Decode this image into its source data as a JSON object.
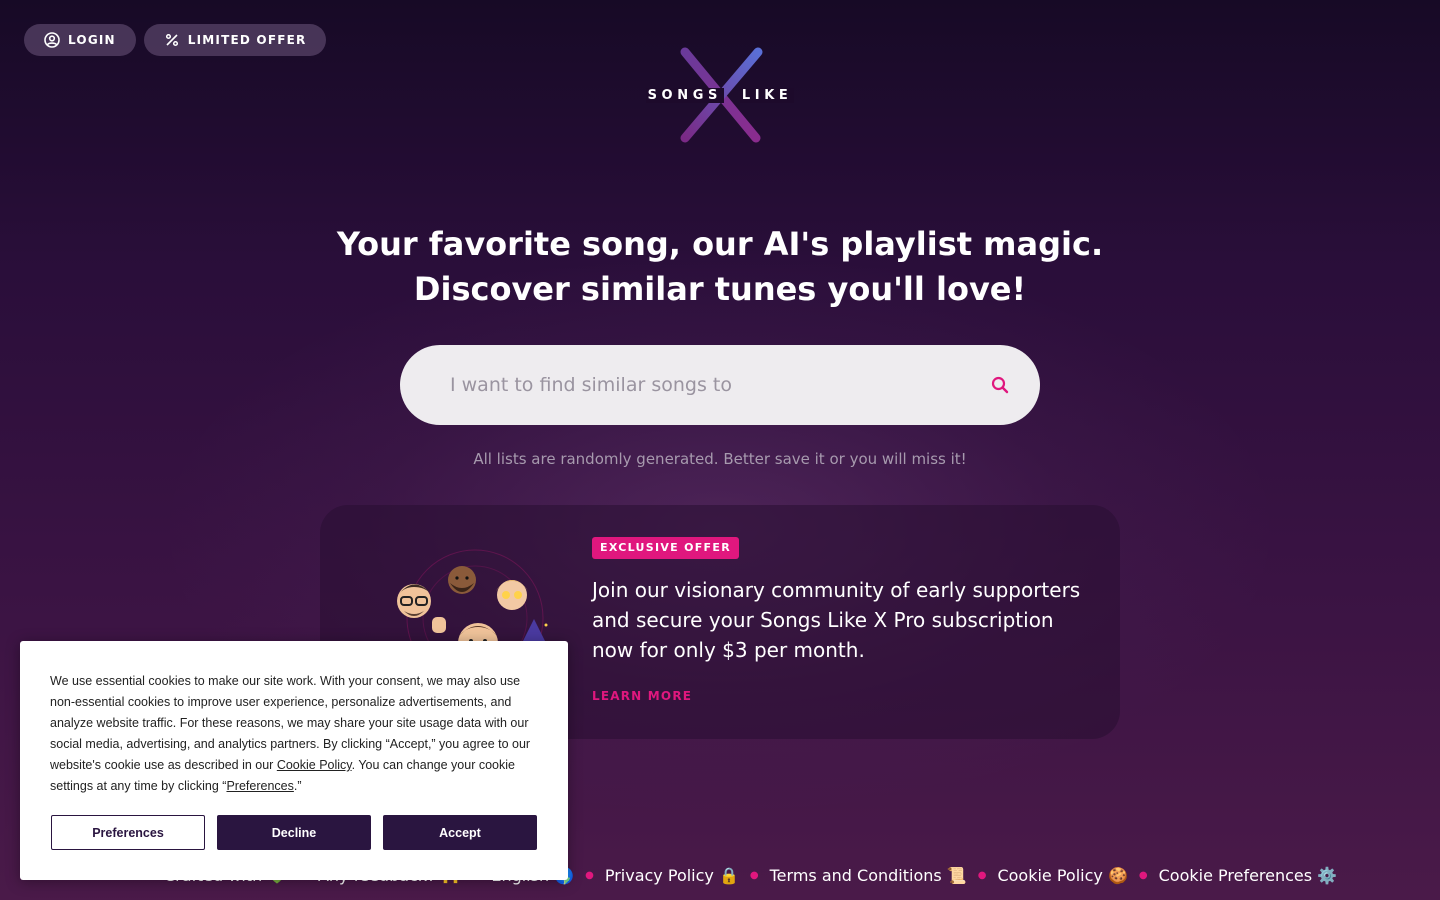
{
  "nav": {
    "login_label": "LOGIN",
    "offer_label": "LIMITED OFFER"
  },
  "logo": {
    "word_left": "SONGS",
    "word_right": "LIKE",
    "mark": "X"
  },
  "hero": {
    "line1": "Your favorite song, our AI's playlist magic.",
    "line2": "Discover similar tunes you'll love!"
  },
  "search": {
    "placeholder": "I want to find similar songs to",
    "value": ""
  },
  "subnote": "All lists are randomly generated. Better save it or you will miss it!",
  "offer": {
    "badge": "EXCLUSIVE OFFER",
    "text": "Join our visionary community of early supporters and secure your Songs Like X Pro subscription now for only $3 per month.",
    "link": "LEARN MORE"
  },
  "footer": {
    "items": [
      "Crafted with 💚",
      "Any feedback? 🙌",
      "English 🌎",
      "Privacy Policy 🔒",
      "Terms and Conditions 📜",
      "Cookie Policy 🍪",
      "Cookie Preferences ⚙️"
    ]
  },
  "cookie": {
    "text_before": "We use essential cookies to make our site work. With your consent, we may also use non-essential cookies to improve user experience, personalize advertisements, and analyze website traffic. For these reasons, we may share your site usage data with our social media, advertising, and analytics partners. By clicking “Accept,” you agree to our website's cookie use as described in our ",
    "policy_link": "Cookie Policy",
    "text_middle": ". You can change your cookie settings at any time by clicking “",
    "preferences_link": "Preferences",
    "text_after": ".”",
    "buttons": {
      "preferences": "Preferences",
      "decline": "Decline",
      "accept": "Accept"
    }
  },
  "colors": {
    "accent": "#e0177e",
    "dark_button": "#2a1540",
    "logo_gradient_start": "#7a2a86",
    "logo_gradient_end": "#5a6fd6"
  }
}
